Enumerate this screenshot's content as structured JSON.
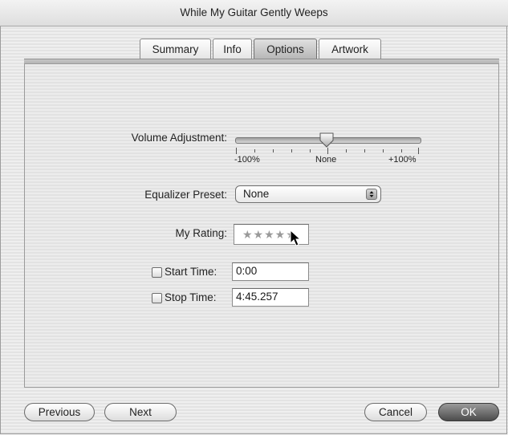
{
  "window": {
    "title": "While My Guitar Gently Weeps"
  },
  "tabs": [
    {
      "label": "Summary",
      "selected": false
    },
    {
      "label": "Info",
      "selected": false
    },
    {
      "label": "Options",
      "selected": true
    },
    {
      "label": "Artwork",
      "selected": false
    }
  ],
  "volume": {
    "label": "Volume Adjustment:",
    "min_label": "-100%",
    "mid_label": "None",
    "max_label": "+100%",
    "value_percent": 0
  },
  "equalizer": {
    "label": "Equalizer Preset:",
    "value": "None"
  },
  "rating": {
    "label": "My Rating:",
    "stars": "★★★★★",
    "value": 0
  },
  "start_time": {
    "label": "Start Time:",
    "value": "0:00",
    "checked": false
  },
  "stop_time": {
    "label": "Stop Time:",
    "value": "4:45.257",
    "checked": false
  },
  "buttons": {
    "previous": "Previous",
    "next": "Next",
    "cancel": "Cancel",
    "ok": "OK"
  },
  "colors": {
    "selected_tab": "#b7b7b7",
    "default_button": "#4c4c4c"
  }
}
